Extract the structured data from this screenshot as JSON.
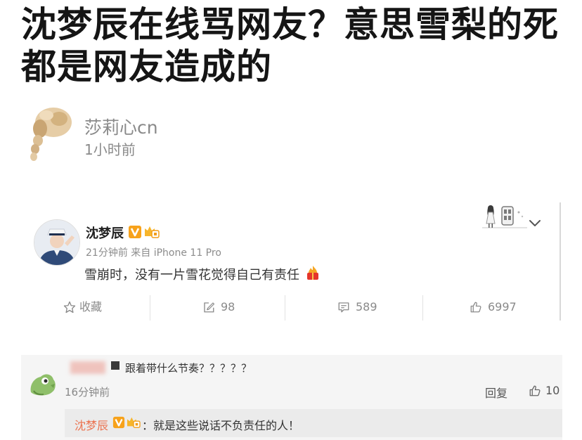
{
  "article": {
    "title_lines": [
      "沈梦辰在线骂网友？意思雪梨的死",
      "都是网友造成的"
    ],
    "author": {
      "name": "莎莉心cn",
      "time": "1小时前"
    }
  },
  "weibo_post": {
    "user": "沈梦辰",
    "meta": "21分钟前 来自 iPhone 11 Pro",
    "content": "雪崩时，没有一片雪花觉得自己有责任",
    "actions": {
      "favorite_label": "收藏",
      "reposts": "98",
      "comments": "589",
      "likes": "6997"
    }
  },
  "comment": {
    "text": "跟着带什么节奏？？？？？",
    "time": "16分钟前",
    "reply_label": "回复",
    "likes": "10",
    "reply": {
      "user": "沈梦辰",
      "text": "：就是这些说话不负责任的人！"
    }
  },
  "icons": {
    "favorite": "star-icon",
    "repost": "edit-icon",
    "comments": "comment-icon",
    "likes": "thumbs-up-icon",
    "verified": "verified-v-icon",
    "level": "level-badge-icon",
    "more": "chevron-down-icon",
    "emoji": "fire-gift-emoji-icon"
  },
  "colors": {
    "link": "#eb7350",
    "verified_badge": "#f7a21b",
    "comment_bg": "#f5f5f5",
    "reply_bg": "#ebebeb"
  }
}
